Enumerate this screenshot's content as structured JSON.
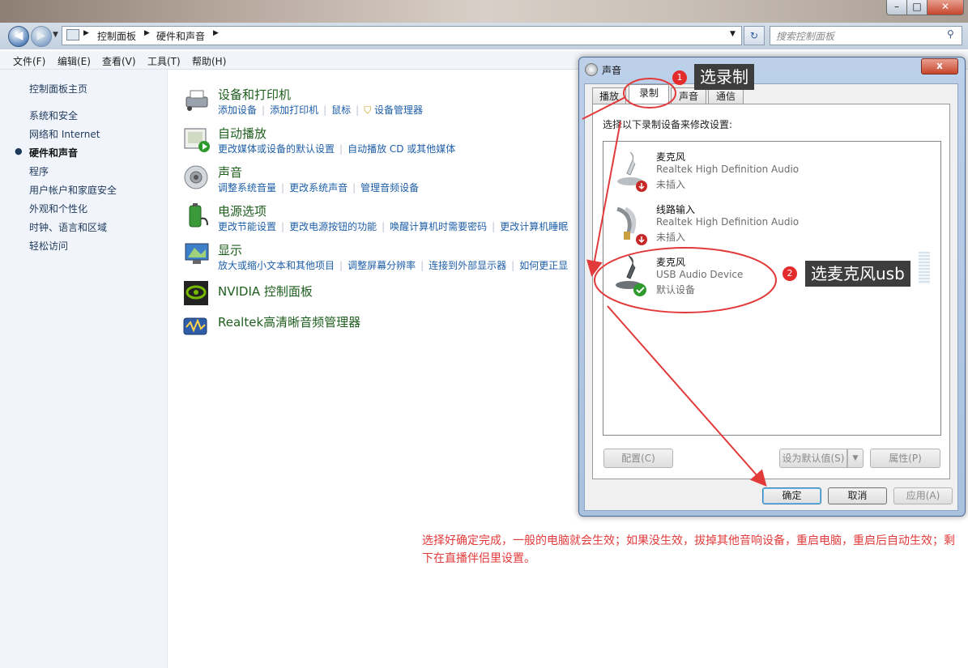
{
  "window": {
    "controls": [
      "–",
      "□",
      "✕"
    ]
  },
  "address": {
    "path": [
      "控制面板",
      "硬件和声音"
    ],
    "search_placeholder": "搜索控制面板"
  },
  "menu": [
    "文件(F)",
    "编辑(E)",
    "查看(V)",
    "工具(T)",
    "帮助(H)"
  ],
  "sidebar": {
    "items": [
      "控制面板主页",
      "系统和安全",
      "网络和 Internet",
      "硬件和声音",
      "程序",
      "用户帐户和家庭安全",
      "外观和个性化",
      "时钟、语言和区域",
      "轻松访问"
    ],
    "active_index": 3
  },
  "categories": [
    {
      "title": "设备和打印机",
      "links": [
        "添加设备",
        "添加打印机",
        "鼠标",
        "设备管理器"
      ]
    },
    {
      "title": "自动播放",
      "links": [
        "更改媒体或设备的默认设置",
        "自动播放 CD 或其他媒体"
      ]
    },
    {
      "title": "声音",
      "links": [
        "调整系统音量",
        "更改系统声音",
        "管理音频设备"
      ]
    },
    {
      "title": "电源选项",
      "links": [
        "更改节能设置",
        "更改电源按钮的功能",
        "唤醒计算机时需要密码",
        "更改计算机睡眠"
      ]
    },
    {
      "title": "显示",
      "links": [
        "放大或缩小文本和其他项目",
        "调整屏幕分辨率",
        "连接到外部显示器",
        "如何更正显"
      ]
    },
    {
      "title": "NVIDIA 控制面板",
      "links": []
    },
    {
      "title": "Realtek高清晰音频管理器",
      "links": []
    }
  ],
  "dialog": {
    "title": "声音",
    "close": "x",
    "tabs": [
      "播放",
      "录制",
      "声音",
      "通信"
    ],
    "instruction": "选择以下录制设备来修改设置:",
    "devices": [
      {
        "name": "麦克风",
        "driver": "Realtek High Definition Audio",
        "status": "未插入"
      },
      {
        "name": "线路输入",
        "driver": "Realtek High Definition Audio",
        "status": "未插入"
      },
      {
        "name": "麦克风",
        "driver": "USB Audio Device",
        "status": "默认设备"
      }
    ],
    "buttons": {
      "configure": "配置(C)",
      "set_default": "设为默认值(S)",
      "properties": "属性(P)",
      "ok": "确定",
      "cancel": "取消",
      "apply": "应用(A)"
    }
  },
  "annotations": {
    "step1": {
      "number": "1",
      "label": "选录制"
    },
    "step2": {
      "number": "2",
      "label": "选麦克风usb"
    },
    "note": "选择好确定完成，一般的电脑就会生效；如果没生效，拔掉其他音响设备，重启电脑，重启后自动生效；剩下在直播伴侣里设置。"
  },
  "colors": {
    "annotation": "#e23a3a",
    "link": "#1e5ea8",
    "category": "#1e5e1e"
  }
}
